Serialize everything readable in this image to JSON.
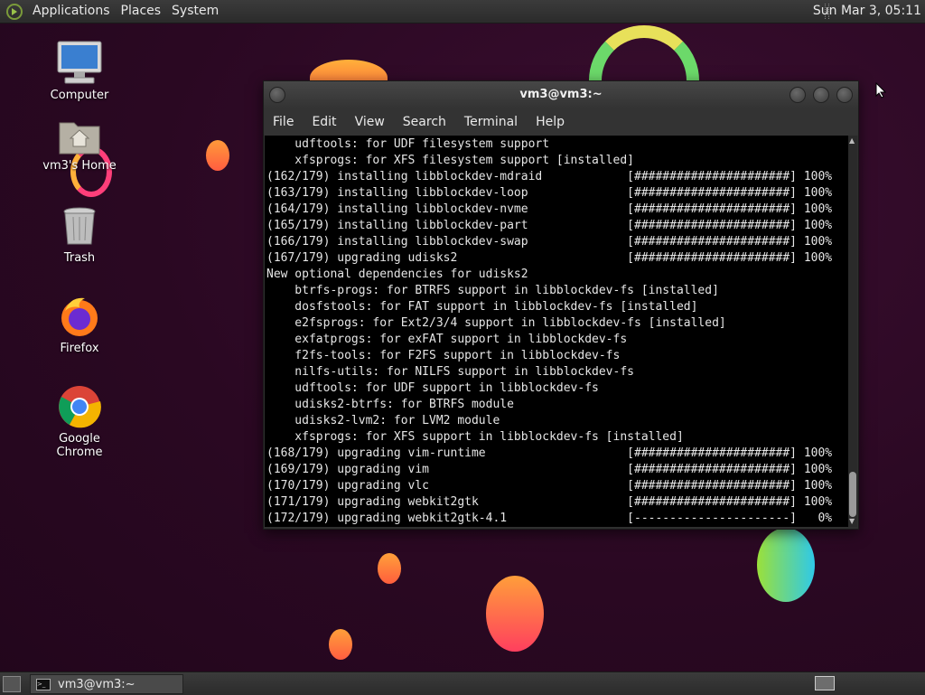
{
  "top_panel": {
    "menus": [
      "Applications",
      "Places",
      "System"
    ],
    "clock": "Sun Mar  3, 05:11"
  },
  "desktop_icons": [
    {
      "label": "Computer",
      "icon": "computer-icon"
    },
    {
      "label": "vm3's Home",
      "icon": "home-folder-icon"
    },
    {
      "label": "Trash",
      "icon": "trash-icon"
    },
    {
      "label": "Firefox",
      "icon": "firefox-icon"
    },
    {
      "label": "Google Chrome",
      "icon": "chrome-icon"
    }
  ],
  "terminal": {
    "title": "vm3@vm3:~",
    "menus": [
      "File",
      "Edit",
      "View",
      "Search",
      "Terminal",
      "Help"
    ],
    "lines": [
      "    udftools: for UDF filesystem support",
      "    xfsprogs: for XFS filesystem support [installed]",
      "(162/179) installing libblockdev-mdraid            [######################] 100%",
      "(163/179) installing libblockdev-loop              [######################] 100%",
      "(164/179) installing libblockdev-nvme              [######################] 100%",
      "(165/179) installing libblockdev-part              [######################] 100%",
      "(166/179) installing libblockdev-swap              [######################] 100%",
      "(167/179) upgrading udisks2                        [######################] 100%",
      "New optional dependencies for udisks2",
      "    btrfs-progs: for BTRFS support in libblockdev-fs [installed]",
      "    dosfstools: for FAT support in libblockdev-fs [installed]",
      "    e2fsprogs: for Ext2/3/4 support in libblockdev-fs [installed]",
      "    exfatprogs: for exFAT support in libblockdev-fs",
      "    f2fs-tools: for F2FS support in libblockdev-fs",
      "    nilfs-utils: for NILFS support in libblockdev-fs",
      "    udftools: for UDF support in libblockdev-fs",
      "    udisks2-btrfs: for BTRFS module",
      "    udisks2-lvm2: for LVM2 module",
      "    xfsprogs: for XFS support in libblockdev-fs [installed]",
      "(168/179) upgrading vim-runtime                    [######################] 100%",
      "(169/179) upgrading vim                            [######################] 100%",
      "(170/179) upgrading vlc                            [######################] 100%",
      "(171/179) upgrading webkit2gtk                     [######################] 100%",
      "(172/179) upgrading webkit2gtk-4.1                 [----------------------]   0%"
    ]
  },
  "taskbar": {
    "task_label": "vm3@vm3:~"
  },
  "colors": {
    "desktop_bg": "#2a0822",
    "panel": "#333333",
    "terminal_bg": "#000000",
    "terminal_fg": "#e6e6e6"
  }
}
